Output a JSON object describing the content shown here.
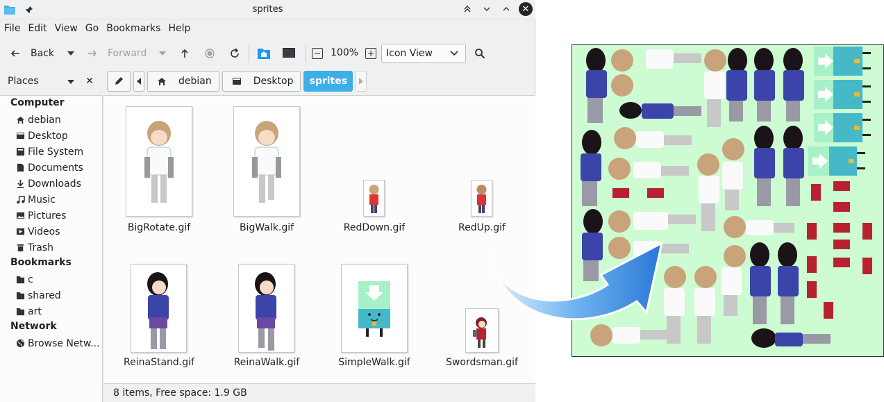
{
  "window": {
    "title": "sprites"
  },
  "menu": [
    "File",
    "Edit",
    "View",
    "Go",
    "Bookmarks",
    "Help"
  ],
  "toolbar": {
    "back": "Back",
    "forward": "Forward",
    "zoom": "100%",
    "view_mode": "Icon View"
  },
  "places": {
    "label": "Places"
  },
  "breadcrumbs": [
    "debian",
    "Desktop",
    "sprites"
  ],
  "sidebar": {
    "computer": "Computer",
    "computer_items": [
      "debian",
      "Desktop",
      "File System",
      "Documents",
      "Downloads",
      "Music",
      "Pictures",
      "Videos",
      "Trash"
    ],
    "bookmarks": "Bookmarks",
    "bookmark_items": [
      "c",
      "shared",
      "art"
    ],
    "network": "Network",
    "network_items": [
      "Browse Netw..."
    ]
  },
  "files": [
    "BigRotate.gif",
    "BigWalk.gif",
    "RedDown.gif",
    "RedUp.gif",
    "ReinaStand.gif",
    "ReinaWalk.gif",
    "SimpleWalk.gif",
    "Swordsman.gif"
  ],
  "status": "8 items, Free space: 1.9 GB",
  "colors": {
    "accent": "#3daee9",
    "sheet_bg": "#cdfbd2",
    "arrow": "#3b8fe3"
  }
}
